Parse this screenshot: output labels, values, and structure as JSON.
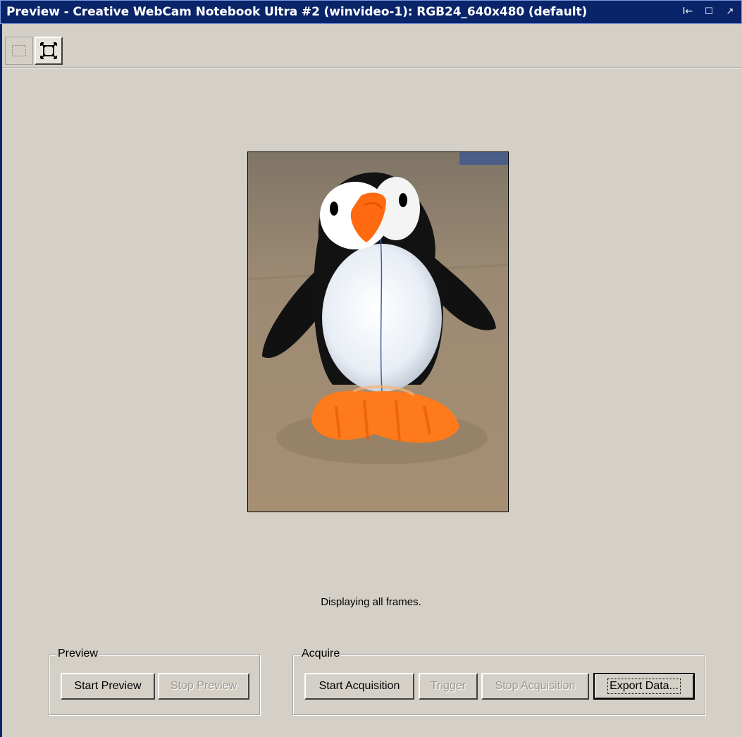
{
  "window": {
    "title": "Preview - Creative WebCam Notebook Ultra #2 (winvideo-1): RGB24_640x480 (default)",
    "controls": [
      "I←",
      "☐",
      "↗"
    ]
  },
  "toolbar": {
    "tools": [
      {
        "name": "select-region",
        "icon": "dotted-rectangle-icon"
      },
      {
        "name": "fit-to-window",
        "icon": "fit-arrows-icon"
      }
    ]
  },
  "preview": {
    "status_text": "Displaying all frames."
  },
  "preview_group": {
    "label": "Preview",
    "start_label": "Start Preview",
    "stop_label": "Stop Preview"
  },
  "acquire_group": {
    "label": "Acquire",
    "start_label": "Start Acquisition",
    "trigger_label": "Trigger",
    "stop_label": "Stop Acquisition",
    "export_label": "Export Data..."
  },
  "colors": {
    "titlebar": "#0a246a",
    "face": "#d4d0c8",
    "penguin_beak": "#ff6a10"
  }
}
